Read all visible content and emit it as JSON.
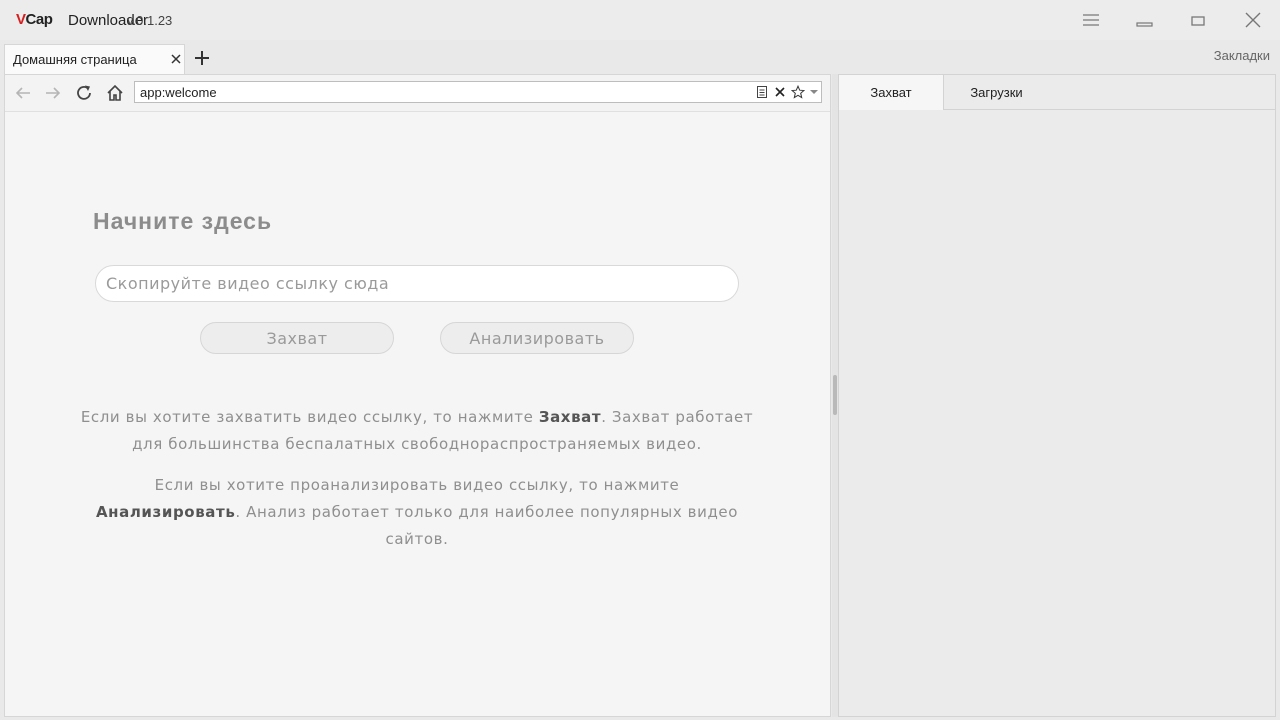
{
  "window": {
    "logo_v": "V",
    "logo_cap": "Cap",
    "app_name": "Downloader",
    "version": "v.0.1.23",
    "controls": [
      "menu-icon",
      "minimize-icon",
      "maximize-icon",
      "close-icon"
    ]
  },
  "tabs": [
    {
      "label": "Домашняя страница",
      "active": true
    }
  ],
  "bookmarks_label": "Закладки",
  "navbar": {
    "buttons": [
      "back-icon",
      "forward-icon",
      "reload-icon",
      "home-icon"
    ],
    "address": "app:welcome",
    "address_icons": [
      "reader-icon",
      "clear-icon",
      "star-icon",
      "dropdown-icon"
    ]
  },
  "welcome": {
    "title": "Начните здесь",
    "input_placeholder": "Скопируйте видео ссылку сюда",
    "input_value": "",
    "capture_button": "Захват",
    "analyze_button": "Анализировать",
    "info1_pre": "Если вы хотите захватить видео ссылку, то нажмите ",
    "info1_bold": "Захват",
    "info1_post": ". Захват работает для большинства беспалатных свободнораспространяемых видео.",
    "info2_pre": "Если вы хотите проанализировать видео ссылку, то нажмите ",
    "info2_bold": "Анализировать",
    "info2_post": ". Анализ работает только для наиболее популярных видео сайтов."
  },
  "right_panel": {
    "tabs": [
      "Захват",
      "Загрузки"
    ],
    "active_tab": "Захват"
  },
  "colors": {
    "logo_accent": "#d81e1e",
    "background": "#e9e9e9",
    "content_bg": "#f5f5f5"
  }
}
